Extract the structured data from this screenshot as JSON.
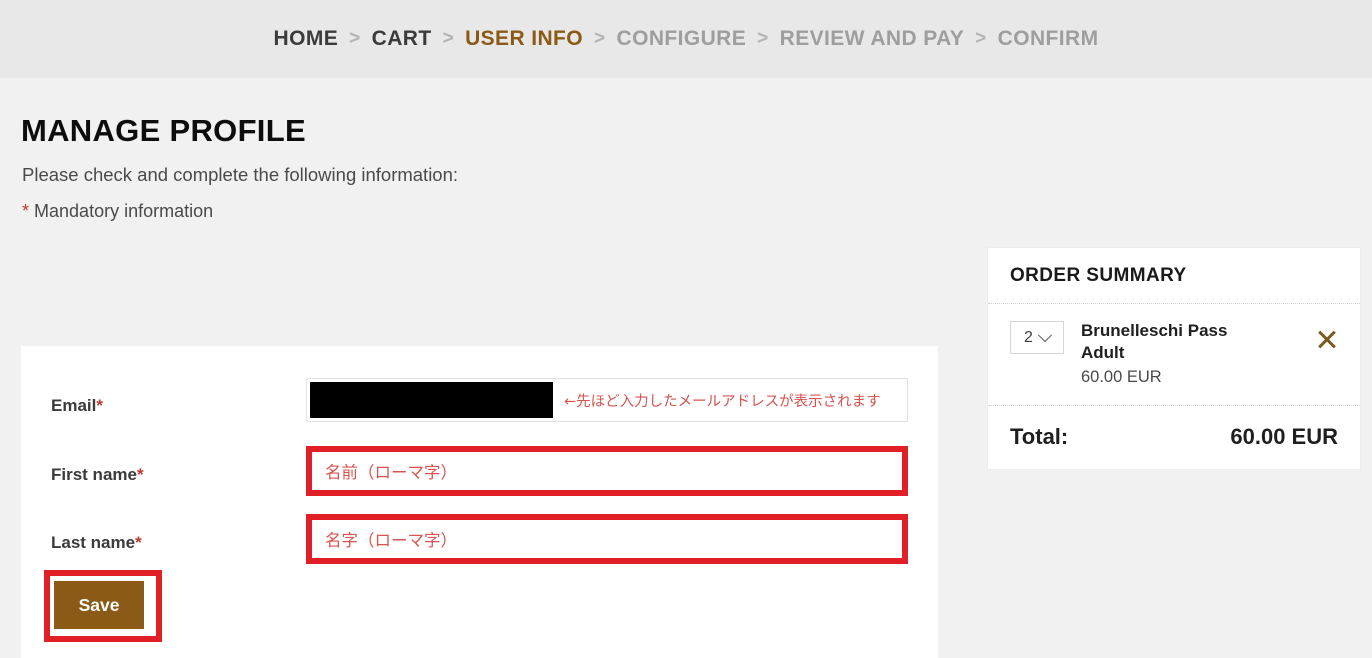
{
  "steps": {
    "separator": ">",
    "items": [
      {
        "label": "HOME",
        "state": "done"
      },
      {
        "label": "CART",
        "state": "done"
      },
      {
        "label": "USER INFO",
        "state": "current"
      },
      {
        "label": "CONFIGURE",
        "state": "todo"
      },
      {
        "label": "REVIEW AND PAY",
        "state": "todo"
      },
      {
        "label": "CONFIRM",
        "state": "todo"
      }
    ]
  },
  "page": {
    "title": "MANAGE PROFILE",
    "subtitle": "Please check and complete the following information:",
    "mandatory_asterisk": "*",
    "mandatory_note": "Mandatory information"
  },
  "form": {
    "email": {
      "label": "Email",
      "required_mark": "*",
      "value": "",
      "redacted": true,
      "annotation": "←先ほど入力したメールアドレスが表示されます"
    },
    "first_name": {
      "label": "First name",
      "required_mark": "*",
      "value": "",
      "annotation": "名前（ローマ字）"
    },
    "last_name": {
      "label": "Last name",
      "required_mark": "*",
      "value": "",
      "annotation": "名字（ローマ字）"
    },
    "save_label": "Save"
  },
  "order_summary": {
    "heading": "ORDER SUMMARY",
    "item": {
      "quantity": "2",
      "name": "Brunelleschi Pass Adult",
      "price": "60.00 EUR",
      "remove_icon": "close-icon"
    },
    "total_label": "Total:",
    "total_value": "60.00 EUR"
  },
  "colors": {
    "accent_brown": "#8a5a16",
    "highlight_red": "#e01f26",
    "annotation_red": "#d9534f",
    "header_bg": "#e8e8e8",
    "page_bg": "#f1f1f1"
  }
}
